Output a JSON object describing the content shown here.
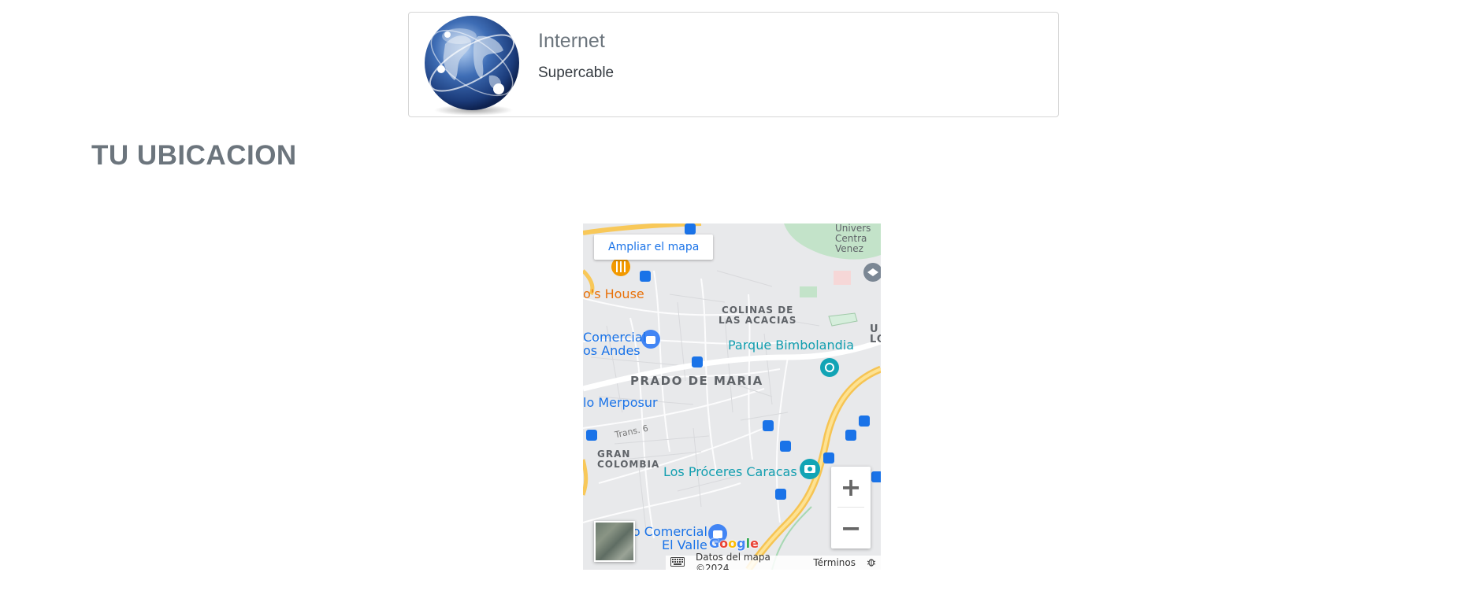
{
  "service": {
    "title": "Internet",
    "provider": "Supercable",
    "icon": "globe-icon"
  },
  "section": {
    "title": "TU UBICACION"
  },
  "map": {
    "enlarge_label": "Ampliar el mapa",
    "zoom_in": "+",
    "zoom_out": "−",
    "labels": {
      "univ_1": "Univers",
      "univ_2": "Centra",
      "univ_3": "Venez",
      "house": "o's House",
      "colinas": "COLINAS DE\nLAS ACACIAS",
      "comercial_1": "Comercial",
      "comercial_2": "os Andes",
      "parque": "Parque Bimbolandia",
      "u_lo": "U\nLO",
      "prado": "PRADO DE MARIA",
      "merposur": "lo Merposur",
      "trans": "Trans. 6",
      "gran_colombia": "GRAN\nCOLOMBIA",
      "proceres": "Los Próceres Caracas",
      "comercial_valle_1": "o Comercial",
      "comercial_valle_2": "El Valle"
    },
    "google": "Google",
    "attribution": {
      "keyboard": "keyboard-icon",
      "data": "Datos del mapa ©2024",
      "terms": "Términos",
      "report": "bug-icon"
    }
  }
}
